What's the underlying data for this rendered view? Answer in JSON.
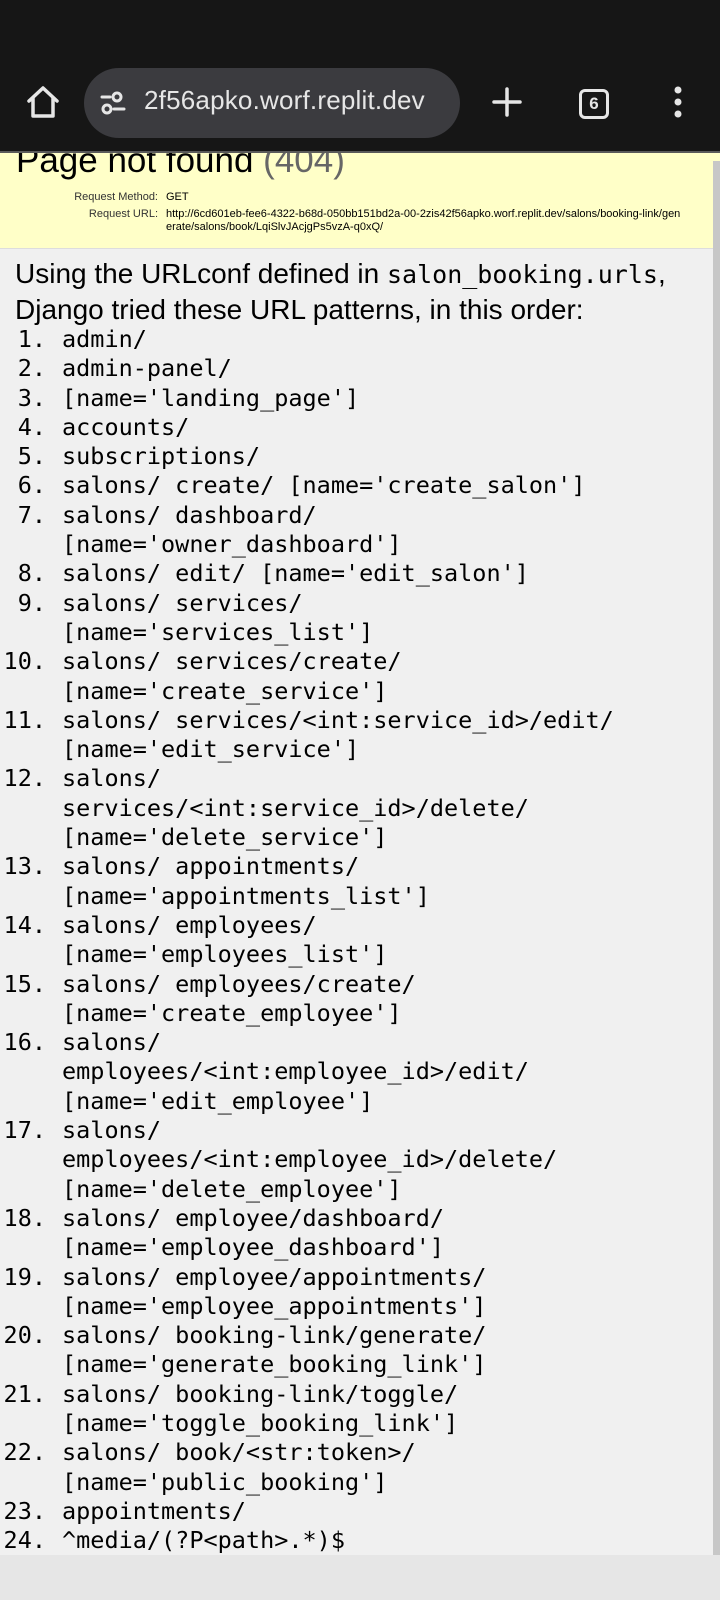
{
  "browser": {
    "url_display": "2f56apko.worf.replit.dev",
    "tab_count": "6",
    "icons": [
      "home-icon",
      "site-settings-icon",
      "new-tab-icon",
      "tab-switcher-icon",
      "overflow-menu-icon"
    ]
  },
  "error": {
    "title": "Page not found",
    "code": "(404)",
    "request_method_label": "Request Method:",
    "request_method": "GET",
    "request_url_label": "Request URL:",
    "request_url": "http://6cd601eb-fee6-4322-b68d-050bb151bd2a-00-2zis42f56apko.worf.replit.dev/salons/booking-link/generate/salons/book/LqiSlvJAcjgPs5vzA-q0xQ/"
  },
  "intro": {
    "prefix": "Using the URLconf defined in ",
    "urlconf": "salon_booking.urls",
    "suffix": ", Django tried these URL patterns, in this order:"
  },
  "patterns": [
    {
      "num": "1.",
      "text": "admin/"
    },
    {
      "num": "2.",
      "text": "admin-panel/"
    },
    {
      "num": "3.",
      "text": "[name='landing_page']"
    },
    {
      "num": "4.",
      "text": "accounts/"
    },
    {
      "num": "5.",
      "text": "subscriptions/"
    },
    {
      "num": "6.",
      "text": "salons/ create/ [name='create_salon']"
    },
    {
      "num": "7.",
      "text": "salons/ dashboard/\n[name='owner_dashboard']"
    },
    {
      "num": "8.",
      "text": "salons/ edit/ [name='edit_salon']"
    },
    {
      "num": "9.",
      "text": "salons/ services/\n[name='services_list']"
    },
    {
      "num": "10.",
      "text": "salons/ services/create/\n[name='create_service']"
    },
    {
      "num": "11.",
      "text": "salons/ services/<int:service_id>/edit/\n[name='edit_service']"
    },
    {
      "num": "12.",
      "text": "salons/\nservices/<int:service_id>/delete/\n[name='delete_service']"
    },
    {
      "num": "13.",
      "text": "salons/ appointments/\n[name='appointments_list']"
    },
    {
      "num": "14.",
      "text": "salons/ employees/\n[name='employees_list']"
    },
    {
      "num": "15.",
      "text": "salons/ employees/create/\n[name='create_employee']"
    },
    {
      "num": "16.",
      "text": "salons/\nemployees/<int:employee_id>/edit/\n[name='edit_employee']"
    },
    {
      "num": "17.",
      "text": "salons/\nemployees/<int:employee_id>/delete/\n[name='delete_employee']"
    },
    {
      "num": "18.",
      "text": "salons/ employee/dashboard/\n[name='employee_dashboard']"
    },
    {
      "num": "19.",
      "text": "salons/ employee/appointments/\n[name='employee_appointments']"
    },
    {
      "num": "20.",
      "text": "salons/ booking-link/generate/\n[name='generate_booking_link']"
    },
    {
      "num": "21.",
      "text": "salons/ booking-link/toggle/\n[name='toggle_booking_link']"
    },
    {
      "num": "22.",
      "text": "salons/ book/<str:token>/\n[name='public_booking']"
    },
    {
      "num": "23.",
      "text": "appointments/"
    },
    {
      "num": "24.",
      "text": "^media/(?P<path>.*)$"
    }
  ]
}
